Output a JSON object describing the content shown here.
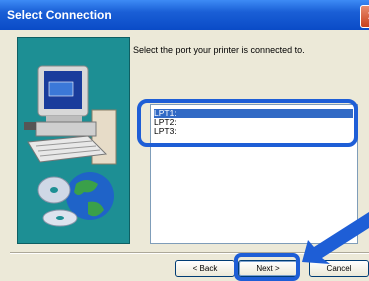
{
  "window": {
    "title": "Select Connection",
    "close_icon": "close-icon"
  },
  "prompt": "Select the port your printer is connected to.",
  "ports": [
    "LPT1:",
    "LPT2:",
    "LPT3:"
  ],
  "selected_port_index": 0,
  "buttons": {
    "back": "< Back",
    "next": "Next >",
    "cancel": "Cancel"
  },
  "colors": {
    "titlebar": "#0a4bc7",
    "panel": "#1d8f94",
    "highlight": "#1e5ed6",
    "selection": "#316ac5"
  }
}
